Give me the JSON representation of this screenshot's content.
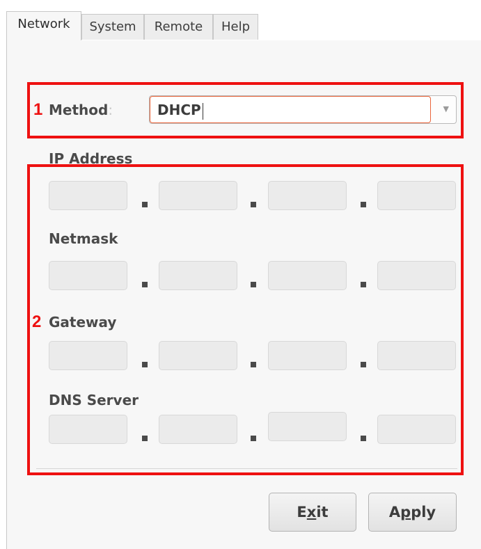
{
  "tabs": [
    {
      "label": "Network",
      "active": true
    },
    {
      "label": "System",
      "active": false
    },
    {
      "label": "Remote",
      "active": false
    },
    {
      "label": "Help",
      "active": false
    }
  ],
  "annotations": {
    "method_number": "1",
    "fields_number": "2",
    "highlight_color": "#ee1111"
  },
  "method": {
    "label": "Method",
    "colon": ":",
    "value": "DHCP",
    "arrow_icon": "chevron-down-icon"
  },
  "fields": [
    {
      "label": "IP Address",
      "octets": [
        "",
        "",
        "",
        ""
      ]
    },
    {
      "label": "Netmask",
      "octets": [
        "",
        "",
        "",
        ""
      ]
    },
    {
      "label": "Gateway",
      "octets": [
        "",
        "",
        "",
        ""
      ]
    },
    {
      "label": "DNS Server",
      "octets": [
        "",
        "",
        "",
        ""
      ]
    }
  ],
  "buttons": {
    "exit": {
      "pre": "E",
      "mnemonic": "x",
      "post": "it"
    },
    "apply": {
      "pre": "A",
      "mnemonic": "p",
      "post": "ply"
    }
  }
}
